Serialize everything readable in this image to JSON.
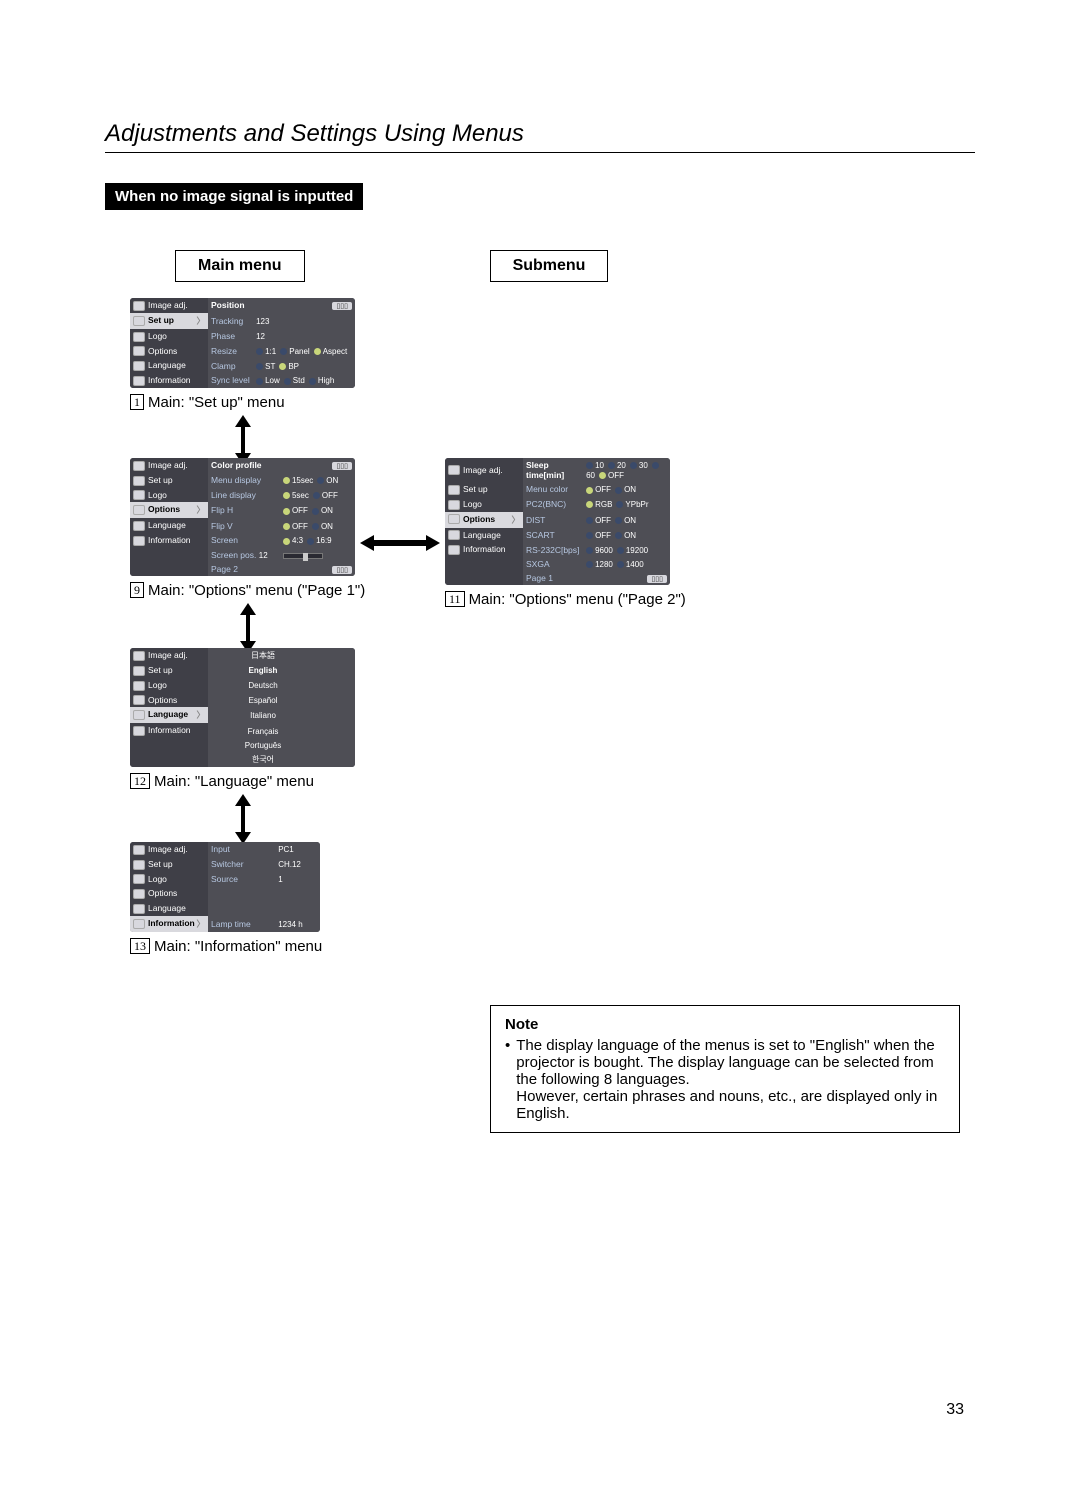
{
  "page": {
    "title": "Adjustments and Settings Using Menus",
    "banner": "When no image signal is inputted",
    "headers": {
      "main": "Main menu",
      "sub": "Submenu"
    },
    "number": "33"
  },
  "sidebar": {
    "items": [
      "Image adj.",
      "Set up",
      "Logo",
      "Options",
      "Language",
      "Information"
    ]
  },
  "captions": {
    "setup": {
      "num": "1",
      "text": "Main: \"Set up\" menu"
    },
    "opt1": {
      "num": "9",
      "text": "Main: \"Options\" menu (\"Page 1\")"
    },
    "opt2": {
      "num": "11",
      "text": "Main: \"Options\" menu (\"Page 2\")"
    },
    "language": {
      "num": "12",
      "text": "Main: \"Language\" menu"
    },
    "info": {
      "num": "13",
      "text": "Main: \"Information\" menu"
    }
  },
  "setup_menu": {
    "rows": [
      {
        "label": "Position",
        "right": ""
      },
      {
        "label": "Tracking",
        "value": "123"
      },
      {
        "label": "Phase",
        "value": "12"
      },
      {
        "label": "Resize",
        "opts": [
          [
            "1:1",
            "off"
          ],
          [
            "Panel",
            "off"
          ],
          [
            "Aspect",
            "on"
          ]
        ]
      },
      {
        "label": "Clamp",
        "opts": [
          [
            "ST",
            "off"
          ],
          [
            "BP",
            "on"
          ]
        ]
      },
      {
        "label": "Sync level",
        "opts": [
          [
            "Low",
            "off"
          ],
          [
            "Std",
            "off"
          ],
          [
            "High",
            "off"
          ]
        ]
      }
    ]
  },
  "opt1_menu": {
    "rows": [
      {
        "label": "Color profile",
        "right": ""
      },
      {
        "label": "Menu display",
        "opts": [
          [
            "15sec",
            "on"
          ],
          [
            "ON",
            "off"
          ]
        ]
      },
      {
        "label": "Line display",
        "opts": [
          [
            "5sec",
            "on"
          ],
          [
            "OFF",
            "off"
          ]
        ]
      },
      {
        "label": "Flip H",
        "opts": [
          [
            "OFF",
            "on"
          ],
          [
            "ON",
            "off"
          ]
        ]
      },
      {
        "label": "Flip V",
        "opts": [
          [
            "OFF",
            "on"
          ],
          [
            "ON",
            "off"
          ]
        ]
      },
      {
        "label": "Screen",
        "opts": [
          [
            "4:3",
            "on"
          ],
          [
            "16:9",
            "off"
          ]
        ]
      },
      {
        "label": "Screen pos.",
        "value": "12",
        "slider": true
      },
      {
        "label": "Page 2",
        "right": ""
      }
    ]
  },
  "opt2_menu": {
    "rows": [
      {
        "label": "Sleep time[min]",
        "opts": [
          [
            "10",
            "off"
          ],
          [
            "20",
            "off"
          ],
          [
            "30",
            "off"
          ],
          [
            "60",
            "off"
          ],
          [
            "OFF",
            "on"
          ]
        ]
      },
      {
        "label": "Menu color",
        "opts": [
          [
            "OFF",
            "on"
          ],
          [
            "ON",
            "off"
          ]
        ]
      },
      {
        "label": "PC2(BNC)",
        "opts": [
          [
            "RGB",
            "on"
          ],
          [
            "YPbPr",
            "off"
          ]
        ]
      },
      {
        "label": "DIST",
        "opts": [
          [
            "OFF",
            "off"
          ],
          [
            "ON",
            "off"
          ]
        ]
      },
      {
        "label": "SCART",
        "opts": [
          [
            "OFF",
            "off"
          ],
          [
            "ON",
            "off"
          ]
        ]
      },
      {
        "label": "RS-232C[bps]",
        "opts": [
          [
            "9600",
            "off"
          ],
          [
            "19200",
            "off"
          ]
        ]
      },
      {
        "label": "SXGA",
        "opts": [
          [
            "1280",
            "off"
          ],
          [
            "1400",
            "off"
          ]
        ]
      },
      {
        "label": "Page 1",
        "right": ""
      }
    ]
  },
  "language_menu": {
    "options": [
      "日本語",
      "English",
      "Deutsch",
      "Español",
      "Italiano",
      "Français",
      "Português",
      "한국어"
    ]
  },
  "info_menu": {
    "rows": [
      {
        "label": "Input",
        "value": "PC1"
      },
      {
        "label": "Switcher",
        "value": "CH.12"
      },
      {
        "label": "Source",
        "value": "1"
      },
      {
        "label": "",
        "value": ""
      },
      {
        "label": "",
        "value": ""
      },
      {
        "label": "Lamp time",
        "value": "1234 h"
      }
    ]
  },
  "note": {
    "heading": "Note",
    "body1": "The display language of the menus is set to \"English\" when the projector is bought. The display language can be selected from the following 8 languages.",
    "body2": "However, certain phrases and nouns, etc., are displayed only in English."
  }
}
